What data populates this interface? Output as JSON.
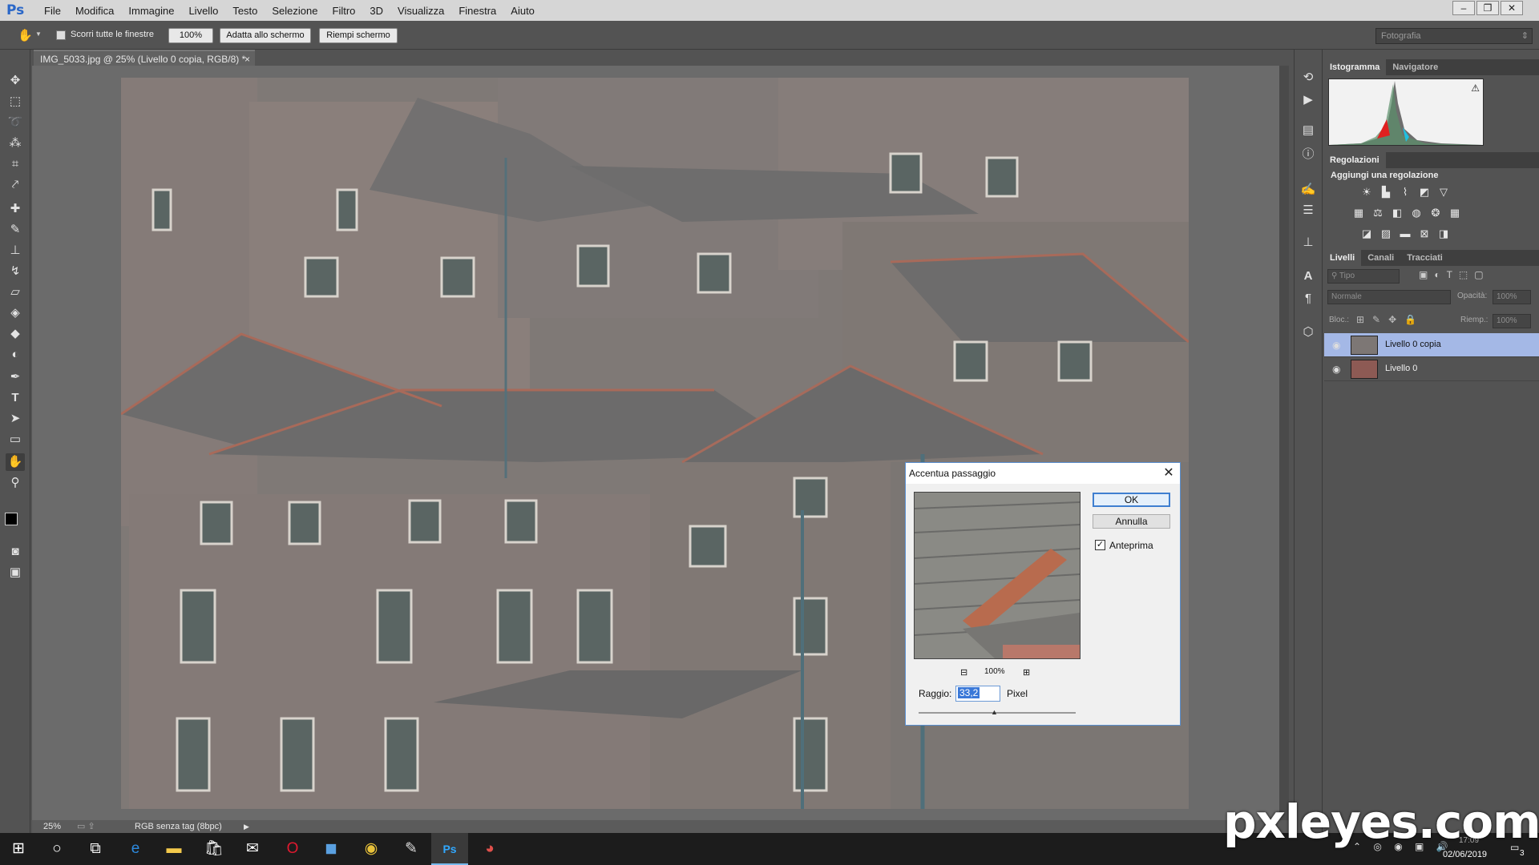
{
  "app": {
    "logo": "Ps"
  },
  "menu": [
    "File",
    "Modifica",
    "Immagine",
    "Livello",
    "Testo",
    "Selezione",
    "Filtro",
    "3D",
    "Visualizza",
    "Finestra",
    "Aiuto"
  ],
  "window_controls": {
    "minimize": "–",
    "restore": "❐",
    "close": "✕"
  },
  "options_bar": {
    "scroll_all_label": "Scorri tutte le finestre",
    "btn_100": "100%",
    "btn_fit": "Adatta allo schermo",
    "btn_fill": "Riempi schermo",
    "workspace": "Fotografia"
  },
  "document": {
    "tab_title": "IMG_5033.jpg @ 25% (Livello 0 copia, RGB/8) *",
    "close": "×"
  },
  "statusbar": {
    "zoom": "25%",
    "profile": "RGB senza tag (8bpc)"
  },
  "panels": {
    "histogram_tabs": [
      "Istogramma",
      "Navigatore"
    ],
    "adjustments_tab": "Regolazioni",
    "adjustments_subtitle": "Aggiungi una regolazione",
    "layers_tabs": [
      "Livelli",
      "Canali",
      "Tracciati"
    ],
    "layers_filter": "Tipo",
    "blend_mode": "Normale",
    "opacity_label": "Opacità:",
    "opacity_value": "100%",
    "lock_label": "Bloc.:",
    "fill_label": "Riemp.:",
    "fill_value": "100%",
    "layers": [
      {
        "name": "Livello 0 copia",
        "selected": true
      },
      {
        "name": "Livello 0",
        "selected": false
      }
    ]
  },
  "dialog": {
    "title": "Accentua passaggio",
    "ok": "OK",
    "cancel": "Annulla",
    "preview_label": "Anteprima",
    "preview_checked": true,
    "zoom": "100%",
    "radius_label": "Raggio:",
    "radius_value": "33,2",
    "unit": "Pixel"
  },
  "taskbar": {
    "time": "17:09",
    "date": "02/06/2019",
    "notifications": "3"
  },
  "watermark": "pxleyes.com",
  "colors": {
    "selection": "#a4b8e6",
    "accent_blue": "#2a67c8"
  }
}
